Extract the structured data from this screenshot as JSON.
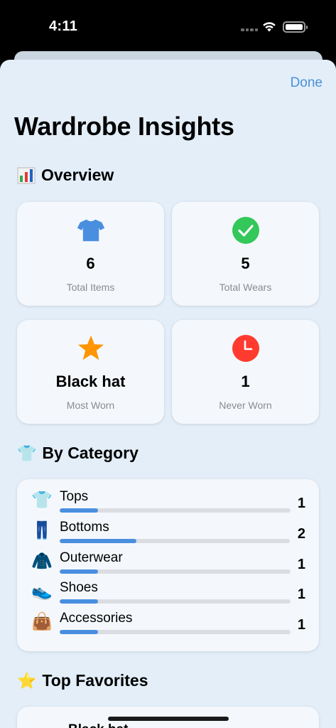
{
  "status_bar": {
    "time": "4:11"
  },
  "sheet": {
    "done_label": "Done",
    "title": "Wardrobe Insights"
  },
  "overview": {
    "header": "Overview",
    "header_icon": "bar-chart-emoji",
    "stats": [
      {
        "value": "6",
        "label": "Total Items",
        "icon": "tshirt-icon",
        "color": "#4a8fdf"
      },
      {
        "value": "5",
        "label": "Total Wears",
        "icon": "checkmark-circle-icon",
        "color": "#34c759"
      },
      {
        "value": "Black hat",
        "label": "Most Worn",
        "icon": "star-icon",
        "color": "#ff9500"
      },
      {
        "value": "1",
        "label": "Never Worn",
        "icon": "clock-icon",
        "color": "#ff3b30"
      }
    ]
  },
  "by_category": {
    "header": "By Category",
    "header_emoji": "👕",
    "items": [
      {
        "emoji": "👕",
        "name": "Tops",
        "count": "1",
        "fraction": 0.166
      },
      {
        "emoji": "👖",
        "name": "Bottoms",
        "count": "2",
        "fraction": 0.333
      },
      {
        "emoji": "🧥",
        "name": "Outerwear",
        "count": "1",
        "fraction": 0.166
      },
      {
        "emoji": "👟",
        "name": "Shoes",
        "count": "1",
        "fraction": 0.166
      },
      {
        "emoji": "👜",
        "name": "Accessories",
        "count": "1",
        "fraction": 0.166
      }
    ]
  },
  "top_favorites": {
    "header": "Top Favorites",
    "header_emoji": "⭐️",
    "first_item_peek": "Black hat"
  }
}
